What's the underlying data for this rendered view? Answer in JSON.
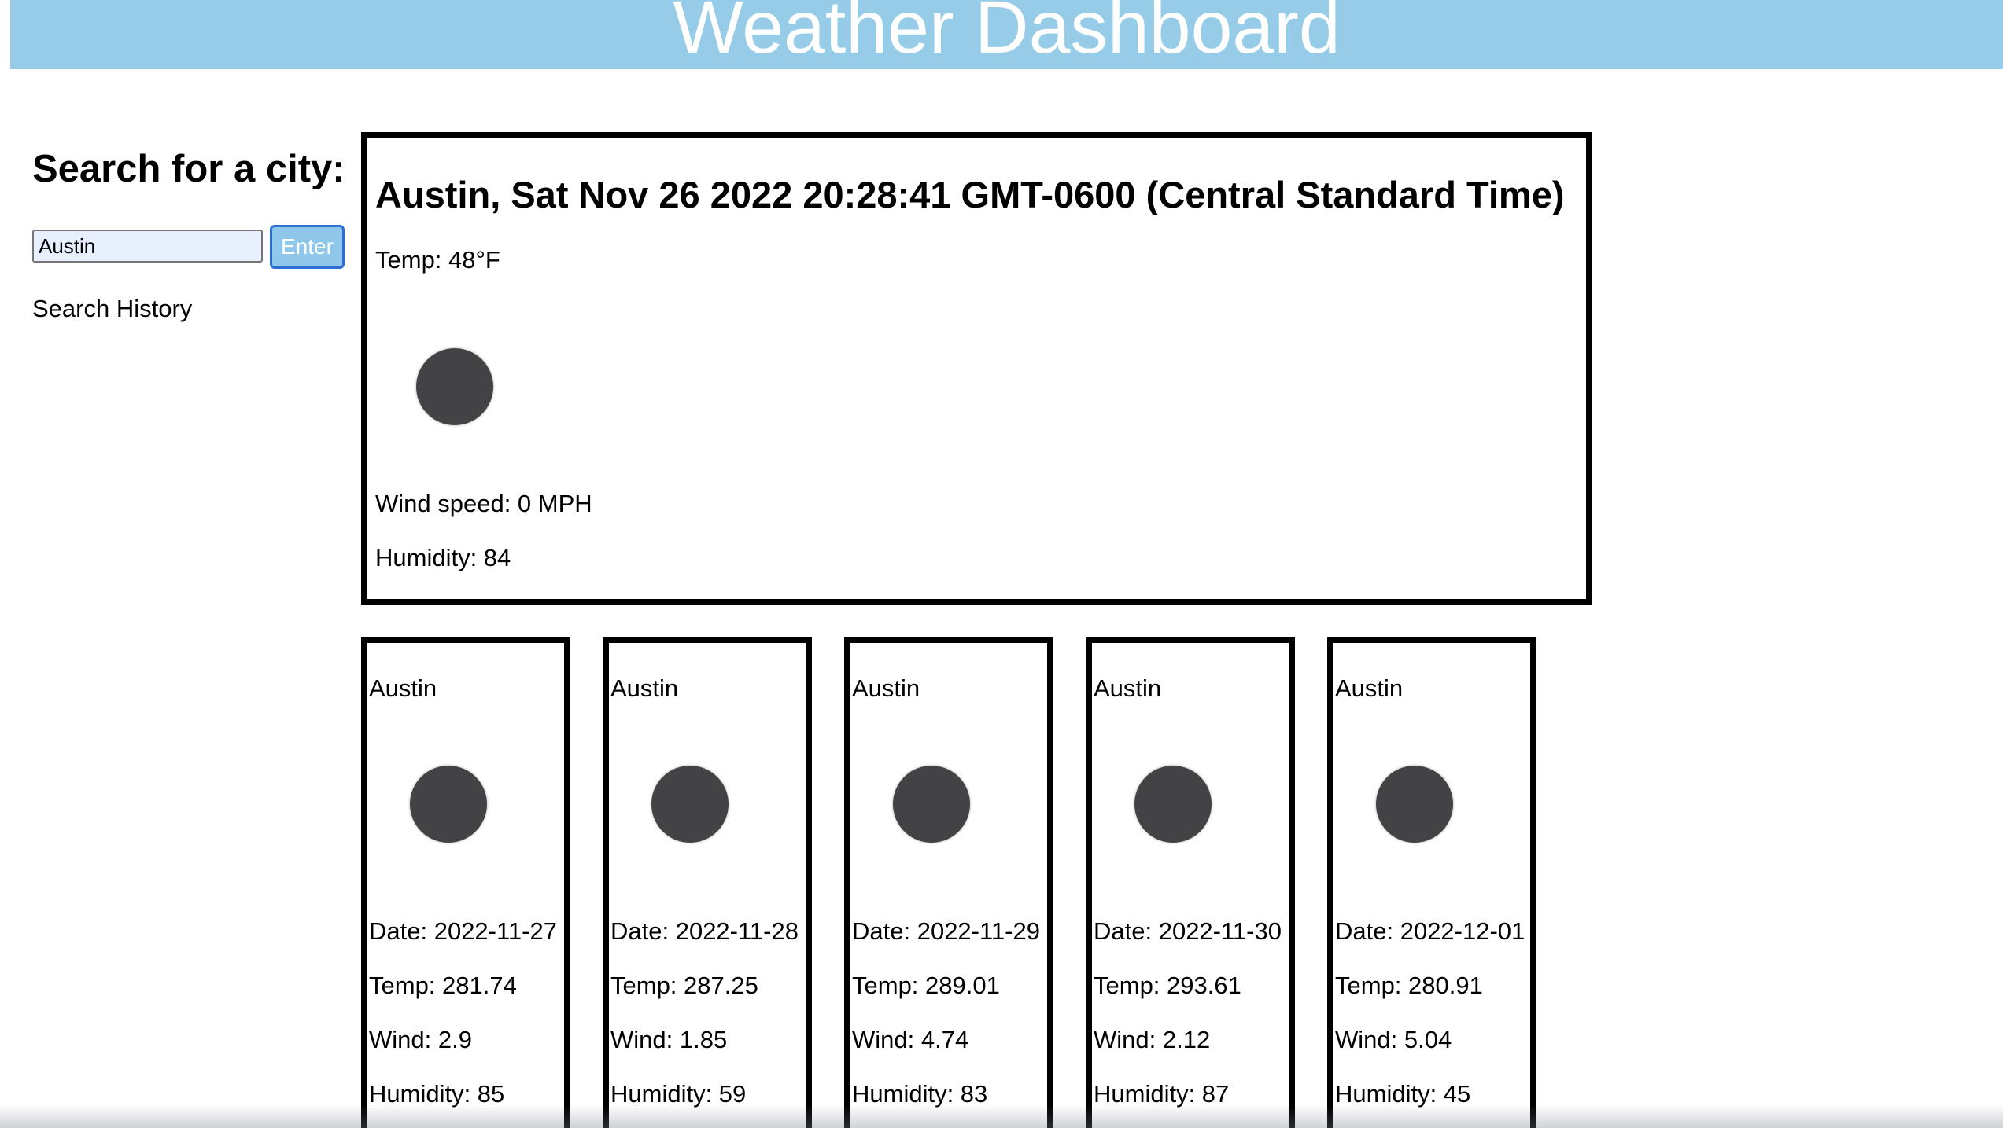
{
  "header": {
    "title": "Weather Dashboard"
  },
  "sidebar": {
    "title": "Search for a city:",
    "search_value": "Austin",
    "enter_label": "Enter",
    "history_label": "Search History"
  },
  "current": {
    "title": "Austin, Sat Nov 26 2022 20:28:41 GMT-0600 (Central Standard Time)",
    "temp": "Temp: 48°F",
    "icon": "weather-icon",
    "wind": "Wind speed: 0 MPH",
    "humidity": "Humidity: 84"
  },
  "forecast": [
    {
      "city": "Austin",
      "icon": "weather-icon",
      "date": "Date: 2022-11-27",
      "temp": "Temp: 281.74",
      "wind": "Wind: 2.9",
      "humidity": "Humidity: 85"
    },
    {
      "city": "Austin",
      "icon": "weather-icon",
      "date": "Date: 2022-11-28",
      "temp": "Temp: 287.25",
      "wind": "Wind: 1.85",
      "humidity": "Humidity: 59"
    },
    {
      "city": "Austin",
      "icon": "weather-icon",
      "date": "Date: 2022-11-29",
      "temp": "Temp: 289.01",
      "wind": "Wind: 4.74",
      "humidity": "Humidity: 83"
    },
    {
      "city": "Austin",
      "icon": "weather-icon",
      "date": "Date: 2022-11-30",
      "temp": "Temp: 293.61",
      "wind": "Wind: 2.12",
      "humidity": "Humidity: 87"
    },
    {
      "city": "Austin",
      "icon": "weather-icon",
      "date": "Date: 2022-12-01",
      "temp": "Temp: 280.91",
      "wind": "Wind: 5.04",
      "humidity": "Humidity: 45"
    }
  ],
  "colors": {
    "header_bg": "#96cce8",
    "header_text": "#ffffff",
    "card_border": "#000000",
    "icon_fill": "#434345",
    "input_bg": "#e8f0fe",
    "button_bg": "#8ec7ea",
    "button_border": "#2c6fd6"
  }
}
